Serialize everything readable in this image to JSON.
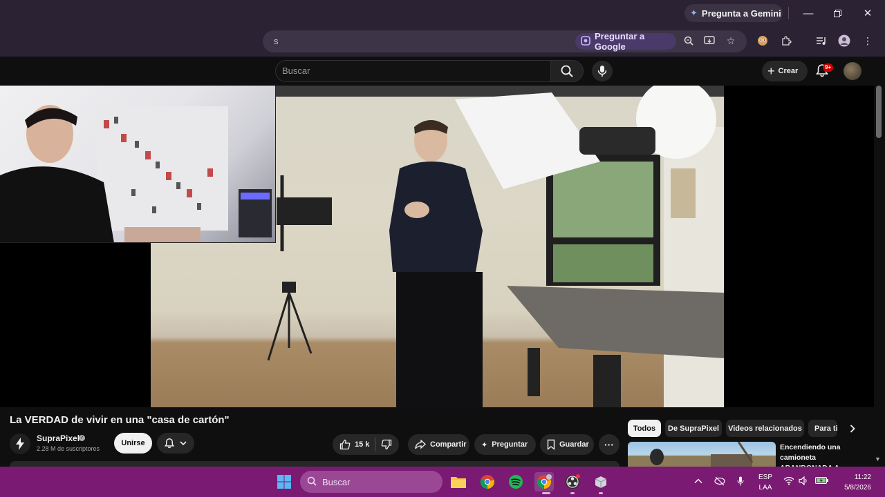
{
  "browser": {
    "gemini_button": "Pregunta a Gemini",
    "omnibox_fragment": "s",
    "ask_google_button": "Preguntar a Google",
    "window_controls": [
      "minimize-icon",
      "restore-icon",
      "close-icon"
    ]
  },
  "header": {
    "search_placeholder": "Buscar",
    "create_label": "Crear",
    "notification_badge": "9+"
  },
  "video": {
    "title": "La VERDAD de vivir en una \"casa de cartón\"",
    "channel": {
      "name": "SupraPixel",
      "subscribers": "2.28 M de suscriptores",
      "verified": true
    },
    "join_label": "Unirse",
    "likes": "15 k",
    "share_label": "Compartir",
    "ask_label": "Preguntar",
    "save_label": "Guardar"
  },
  "chips": [
    "Todos",
    "De SupraPixel",
    "Videos relacionados",
    "Para ti"
  ],
  "recommended": [
    {
      "title": "Encendiendo una camioneta ABANDONADA A ..."
    }
  ],
  "taskbar": {
    "search_label": "Buscar",
    "language_line1": "ESP",
    "language_line2": "LAA",
    "time": "11:22",
    "date": "5/8/2026",
    "accent_color": "#7a1a72"
  },
  "colors": {
    "youtube_background": "#0f0f0f",
    "chrome_frame": "#2b2233",
    "ask_google_accent": "#4a3a6a"
  }
}
